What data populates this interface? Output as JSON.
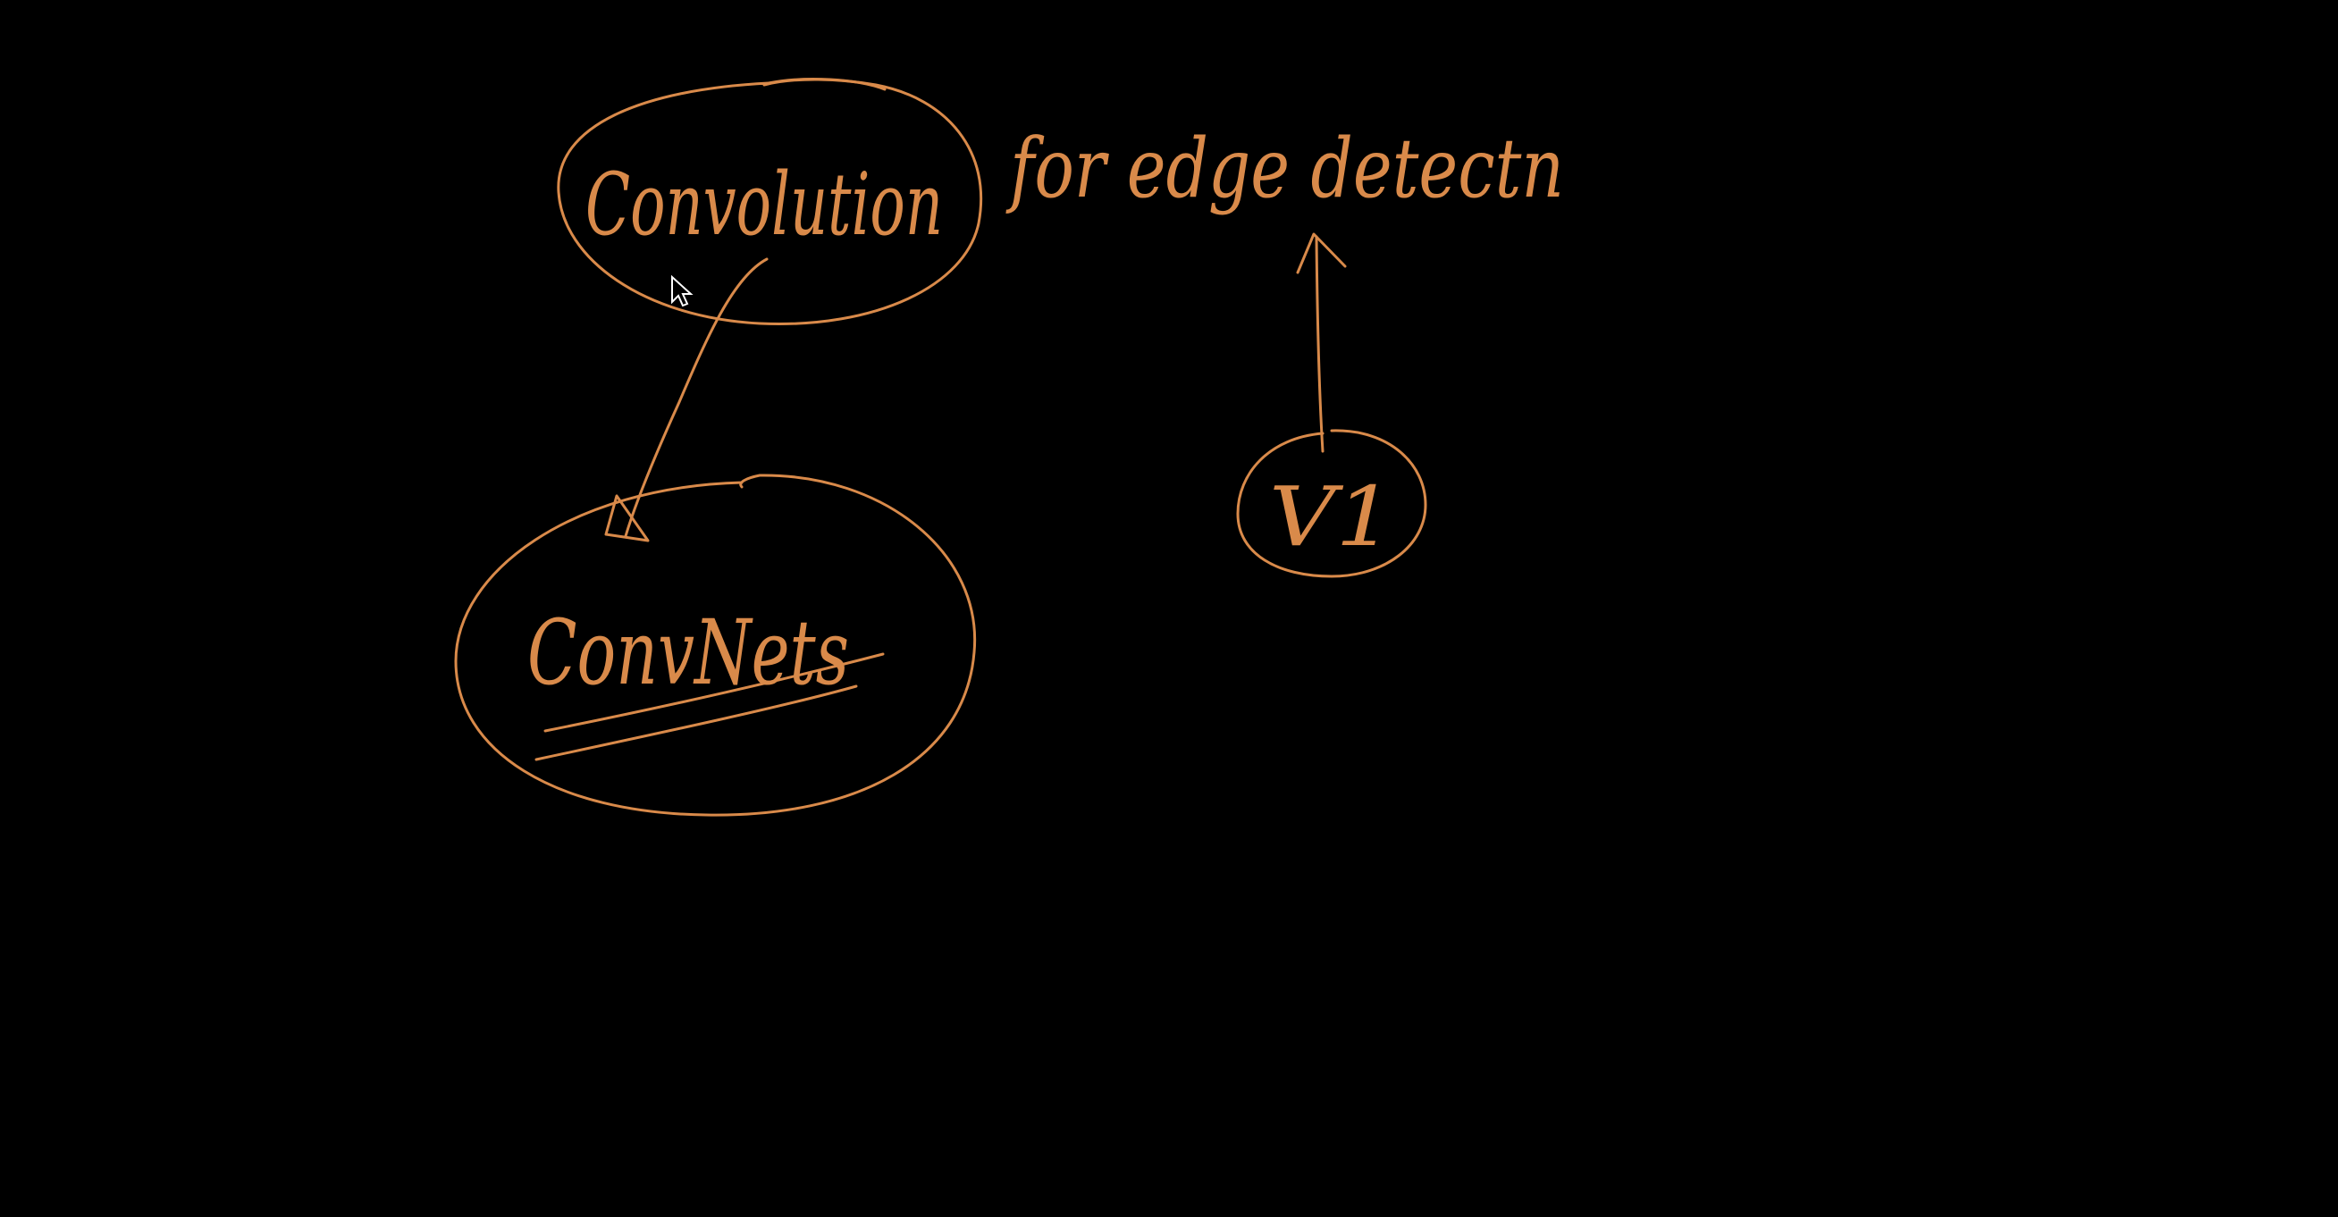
{
  "board": {
    "background": "#000000",
    "ink_color": "#d98a4a"
  },
  "nodes": {
    "convolution": {
      "label": "Convolution"
    },
    "convnets": {
      "label": "ConvNets"
    },
    "v1": {
      "label": "V1"
    }
  },
  "annotations": {
    "edge_detection": "for edge detectn"
  },
  "cursor": {
    "icon": "mouse-pointer-icon"
  }
}
